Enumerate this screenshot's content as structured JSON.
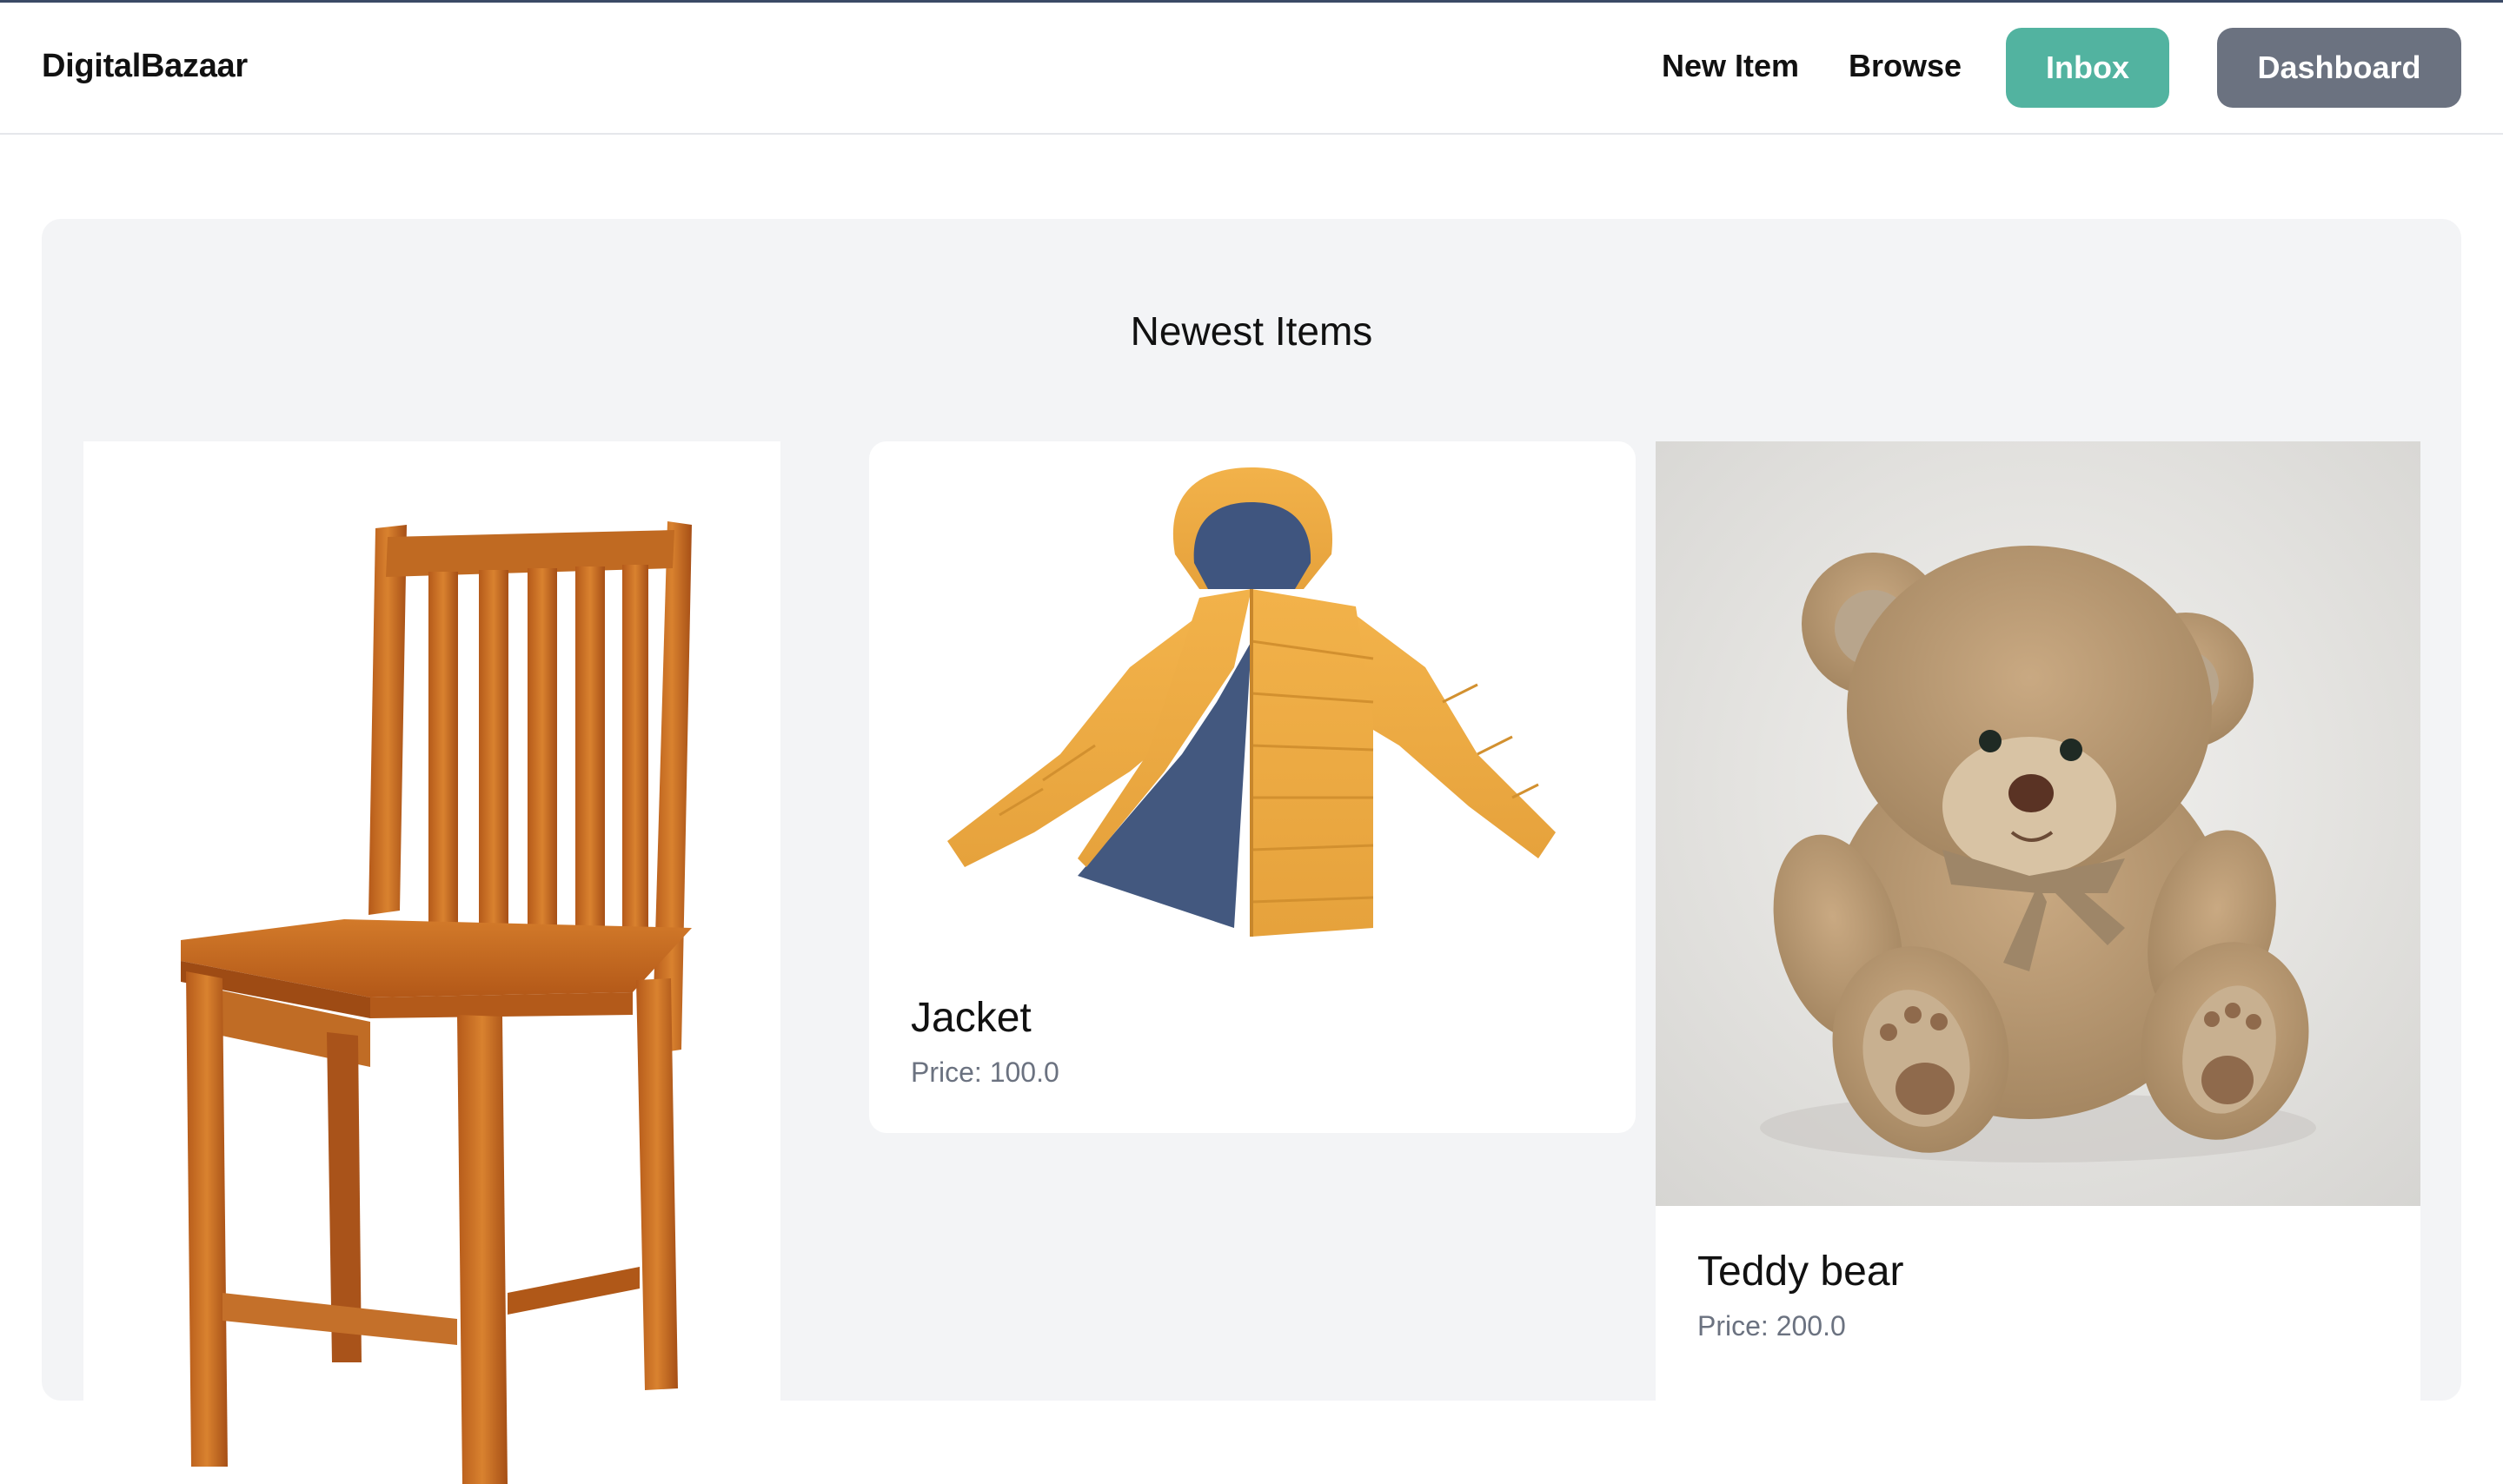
{
  "brand": "DigitalBazaar",
  "nav": {
    "new_item": "New Item",
    "browse": "Browse",
    "inbox": "Inbox",
    "dashboard": "Dashboard"
  },
  "section": {
    "title": "Newest Items"
  },
  "items": [
    {
      "name": "",
      "price": "",
      "image": "wooden-chair"
    },
    {
      "name": "Jacket",
      "price": "Price: 100.0",
      "image": "yellow-puffer-jacket"
    },
    {
      "name": "Teddy bear",
      "price": "Price: 200.0",
      "image": "teddy-bear"
    }
  ],
  "colors": {
    "inbox_button": "#52b3a0",
    "dashboard_button": "#6b7280",
    "section_bg": "#f3f4f6",
    "top_line": "#3b4a66"
  }
}
